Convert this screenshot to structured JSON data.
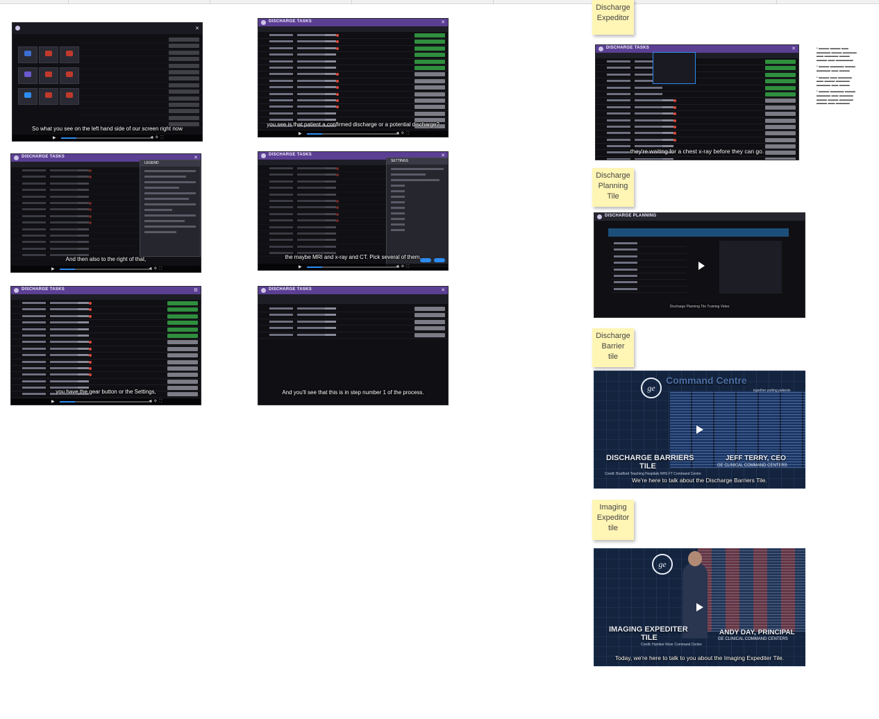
{
  "videos": {
    "v1": {
      "caption": "So what you see on the left hand side of our screen right now"
    },
    "v2": {
      "app_title": "DISCHARGE TASKS",
      "caption": "you see is that patient a confirmed discharge or a potential discharge?"
    },
    "v3": {
      "app_title": "DISCHARGE TASKS",
      "panel_title": "LEGEND",
      "caption": "And then also to the right of that,"
    },
    "v4": {
      "app_title": "DISCHARGE TASKS",
      "panel_title": "SETTINGS",
      "caption": "the maybe MRI and x-ray and CT. Pick several of them."
    },
    "v5": {
      "app_title": "DISCHARGE TASKS",
      "caption": "you have the gear button or the Settings,"
    },
    "v6": {
      "app_title": "DISCHARGE TASKS",
      "caption": "And you'll see that this is in step number 1 of the process."
    }
  },
  "stickies": {
    "s1": {
      "line1": "Discharge",
      "line2": "Expeditor"
    },
    "s2": {
      "line1": "Discharge",
      "line2": "Planning",
      "line3": "Tile"
    },
    "s3": {
      "line1": "Discharge",
      "line2": "Barrier",
      "line3": "tile"
    },
    "s4": {
      "line1": "Imaging",
      "line2": "Expeditor",
      "line3": "tile"
    }
  },
  "right": {
    "expeditor": {
      "app_title": "DISCHARGE TASKS",
      "caption": "they're waiting for a chest x-ray before they can go."
    },
    "planning": {
      "app_title": "DISCHARGE PLANNING",
      "caption": "Discharge Planning Tile Training Video"
    },
    "barriers": {
      "brand": "Command Centre",
      "tagline": "together putting patients",
      "title_line1": "DISCHARGE BARRIERS",
      "title_line2": "TILE",
      "credit": "Credit: Bradford Teaching Hospitals NHS FT Command Centre",
      "speaker": "JEFF TERRY, CEO",
      "speaker_org": "GE CLINICAL COMMAND CENTERS",
      "caption": "We're here to talk about the Discharge Barriers Tile."
    },
    "imaging": {
      "title_line1": "IMAGING EXPEDITER",
      "title_line2": "TILE",
      "credit": "Credit: Humber River Command Centre",
      "speaker": "ANDY DAY, PRINCIPAL",
      "speaker_org": "GE CLINICAL COMMAND CENTERS",
      "caption": "Today, we're here to talk to you about the Imaging Expediter Tile."
    }
  }
}
